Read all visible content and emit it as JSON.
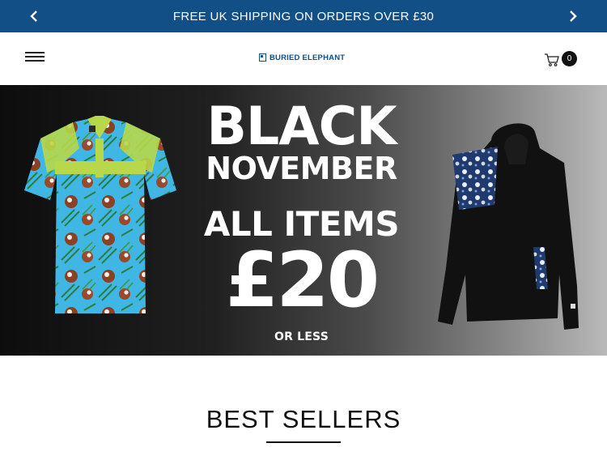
{
  "announcement": {
    "text": "FREE UK SHIPPING ON ORDERS OVER £30",
    "prev_icon": "chevron-left-icon",
    "next_icon": "chevron-right-icon"
  },
  "header": {
    "menu_icon": "hamburger-menu-icon",
    "logo_text": "BURIED ELEPHANT",
    "cart_icon": "shopping-cart-icon",
    "cart_count": "0"
  },
  "hero": {
    "line1": "BLACK",
    "line2": "NOVEMBER",
    "line3": "ALL ITEMS",
    "line4": "£20",
    "line5": "OR LESS"
  },
  "best_sellers": {
    "title": "BEST SELLERS"
  },
  "colors": {
    "announcement_bg": "#114f86",
    "brand_blue": "#114f86",
    "polo_blue": "#39b6e6",
    "polo_accent": "#b8d94a"
  }
}
